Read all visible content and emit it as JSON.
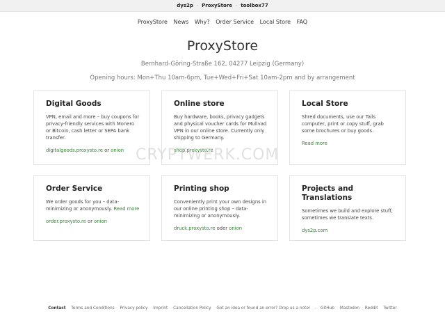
{
  "topbar": {
    "items": [
      "dys2p",
      "ProxyStore",
      "toolbox77"
    ],
    "separator": "·"
  },
  "nav": {
    "items": [
      "ProxyStore",
      "News",
      "Why?",
      "Order Service",
      "Local Store",
      "FAQ"
    ]
  },
  "header": {
    "title": "ProxyStore",
    "address": "Bernhard-Göring-Straße 162, 04277 Leipzig (Germany)",
    "hours": "Opening hours: Mon+Thu 10am-6pm, Tue+Wed+Fri+Sat 10am-2pm and by arrangement"
  },
  "cards": [
    {
      "title": "Digital Goods",
      "text": "VPN, email and more – buy coupons for privacy-friendly services with Monero or Bitcoin, cash letter or SEPA bank transfer.",
      "link1": "digitalgoods.proxysto.re",
      "joiner": "or",
      "link2": "onion"
    },
    {
      "title": "Online store",
      "text": "Buy hardware, books, privacy gadgets and physical voucher cards for Mullvad VPN in our online store. Currently only shipping to Germany.",
      "link1": "shop.proxysto.re"
    },
    {
      "title": "Local Store",
      "text": "Shred documents, use our Tails computer, print or copy stuff, grab some brochures or buy goods.",
      "readmore": "Read more"
    },
    {
      "title": "Order Service",
      "text": "We order goods for you – data-minimizing or anonymously.",
      "readmore": "Read more",
      "link1": "order.proxysto.re",
      "joiner": "or",
      "link2": "onion"
    },
    {
      "title": "Printing shop",
      "text": "Conveniently print your own designs in our online printing shop – data-minimizing or anonymously.",
      "link1": "druck.proxysto.re",
      "joiner": "oder",
      "link2": "onion"
    },
    {
      "title": "Projects and Translations",
      "text": "Sometimes we build and explore stuff, sometimes we translate texts.",
      "link1": "dys2p.com"
    }
  ],
  "watermark": "CRYPTWERK.COM",
  "footer": {
    "items": [
      "Contact",
      "Terms and Conditions",
      "Privacy policy",
      "Imprint",
      "Cancellation Policy",
      "Got an idea or found an error? Drop us a note!",
      "GitHub",
      "Mastodon",
      "Reddit",
      "Twitter"
    ],
    "separator": "–"
  }
}
